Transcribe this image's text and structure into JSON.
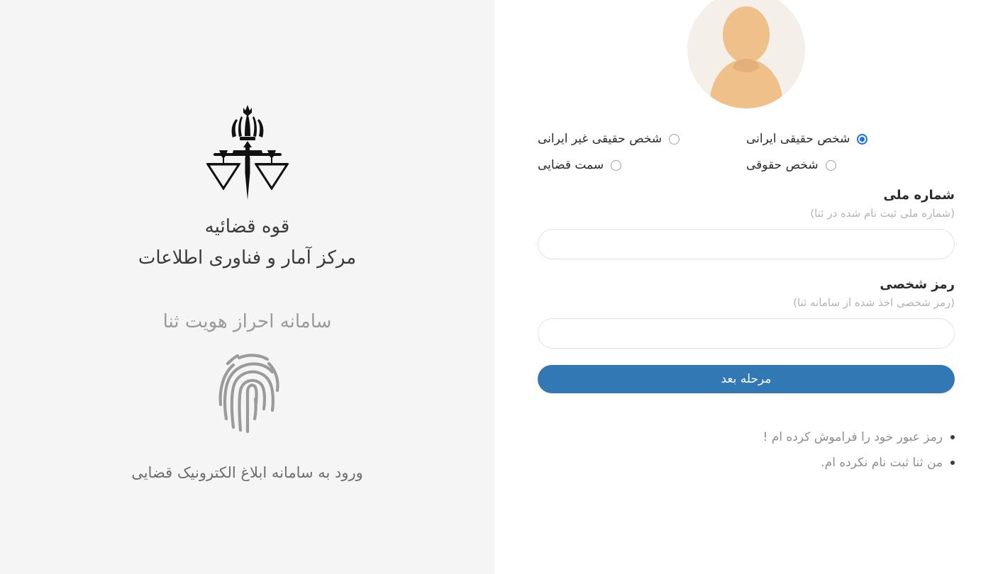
{
  "branding": {
    "emblem_icon": "judiciary-scales-emblem-icon",
    "organization": "قوه قضائیه",
    "department": "مرکز آمار و فناوری اطلاعات",
    "system_name": "سامانه احراز هویت ثنا",
    "fingerprint_icon": "fingerprint-icon",
    "entry_text": "ورود به سامانه ابلاغ الکترونیک قضایی",
    "panel_background": "#f5f5f5"
  },
  "form": {
    "avatar_icon": "user-avatar-placeholder",
    "identity_options": [
      {
        "label": "شخص حقیقی ایرانی",
        "selected": true
      },
      {
        "label": "شخص حقیقی غیر ایرانی",
        "selected": false
      },
      {
        "label": "شخص حقوقی",
        "selected": false
      },
      {
        "label": "سمت قضایی",
        "selected": false
      }
    ],
    "national_id": {
      "label": "شماره ملی",
      "hint": "(شماره ملی ثبت نام شده در ثنا)",
      "value": "",
      "placeholder": ""
    },
    "password": {
      "label": "رمز شخصی",
      "hint": "(رمز شخصی اخذ شده از سامانه ثنا)",
      "value": "",
      "placeholder": ""
    },
    "submit_label": "مرحله بعد",
    "submit_color": "#3178b4",
    "links": [
      {
        "label": "رمز عبور خود را فراموش کرده ام !"
      },
      {
        "label": "من ثنا ثبت نام نکرده ام."
      }
    ]
  }
}
